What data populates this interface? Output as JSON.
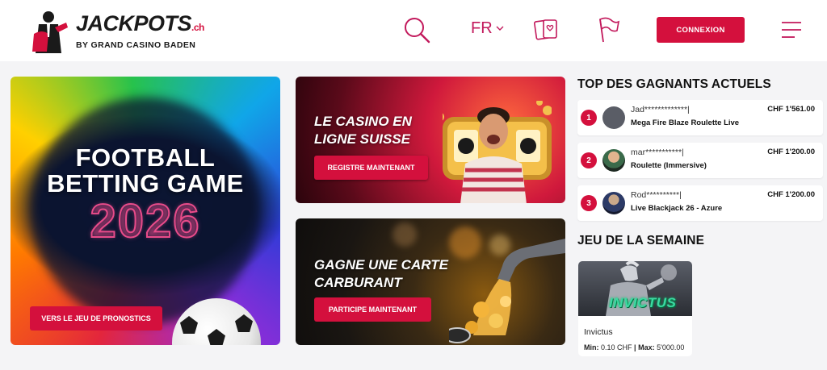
{
  "brand": {
    "logo_main": "JACKPOTS",
    "logo_tld": ".ch",
    "logo_sub": "BY GRAND CASINO BADEN",
    "accent": "#d4103d"
  },
  "header": {
    "language": "FR",
    "login_label": "CONNEXION",
    "icons": [
      "search-icon",
      "chevron-down-icon",
      "cards-icon",
      "start-flag-icon",
      "menu-icon"
    ]
  },
  "banners": {
    "football": {
      "title_line1": "FOOTBALL",
      "title_line2": "BETTING GAME",
      "year": "2026",
      "cta": "VERS LE JEU DE PRONOSTICS"
    },
    "casino": {
      "title_line1": "LE CASINO EN",
      "title_line2": "LIGNE SUISSE",
      "cta": "REGISTRE MAINTENANT"
    },
    "fuel": {
      "title_line1": "GAGNE UNE CARTE",
      "title_line2": "CARBURANT",
      "cta": "PARTICIPE MAINTENANT"
    }
  },
  "winners": {
    "title": "TOP DES GAGNANTS ACTUELS",
    "items": [
      {
        "rank": "1",
        "name": "Jad*************|",
        "game": "Mega Fire Blaze Roulette Live",
        "amount": "CHF 1'561.00"
      },
      {
        "rank": "2",
        "name": "mar***********|",
        "game": "Roulette (Immersive)",
        "amount": "CHF 1'200.00"
      },
      {
        "rank": "3",
        "name": "Rod**********|",
        "game": "Live Blackjack 26 - Azure",
        "amount": "CHF 1'200.00"
      }
    ]
  },
  "game_of_week": {
    "title": "JEU DE LA SEMAINE",
    "logo_text": "INVICTUS",
    "name": "Invictus",
    "min_label": "Min:",
    "min_value": "0.10 CHF",
    "separator": "|",
    "max_label": "Max:",
    "max_value": "5'000.00"
  }
}
